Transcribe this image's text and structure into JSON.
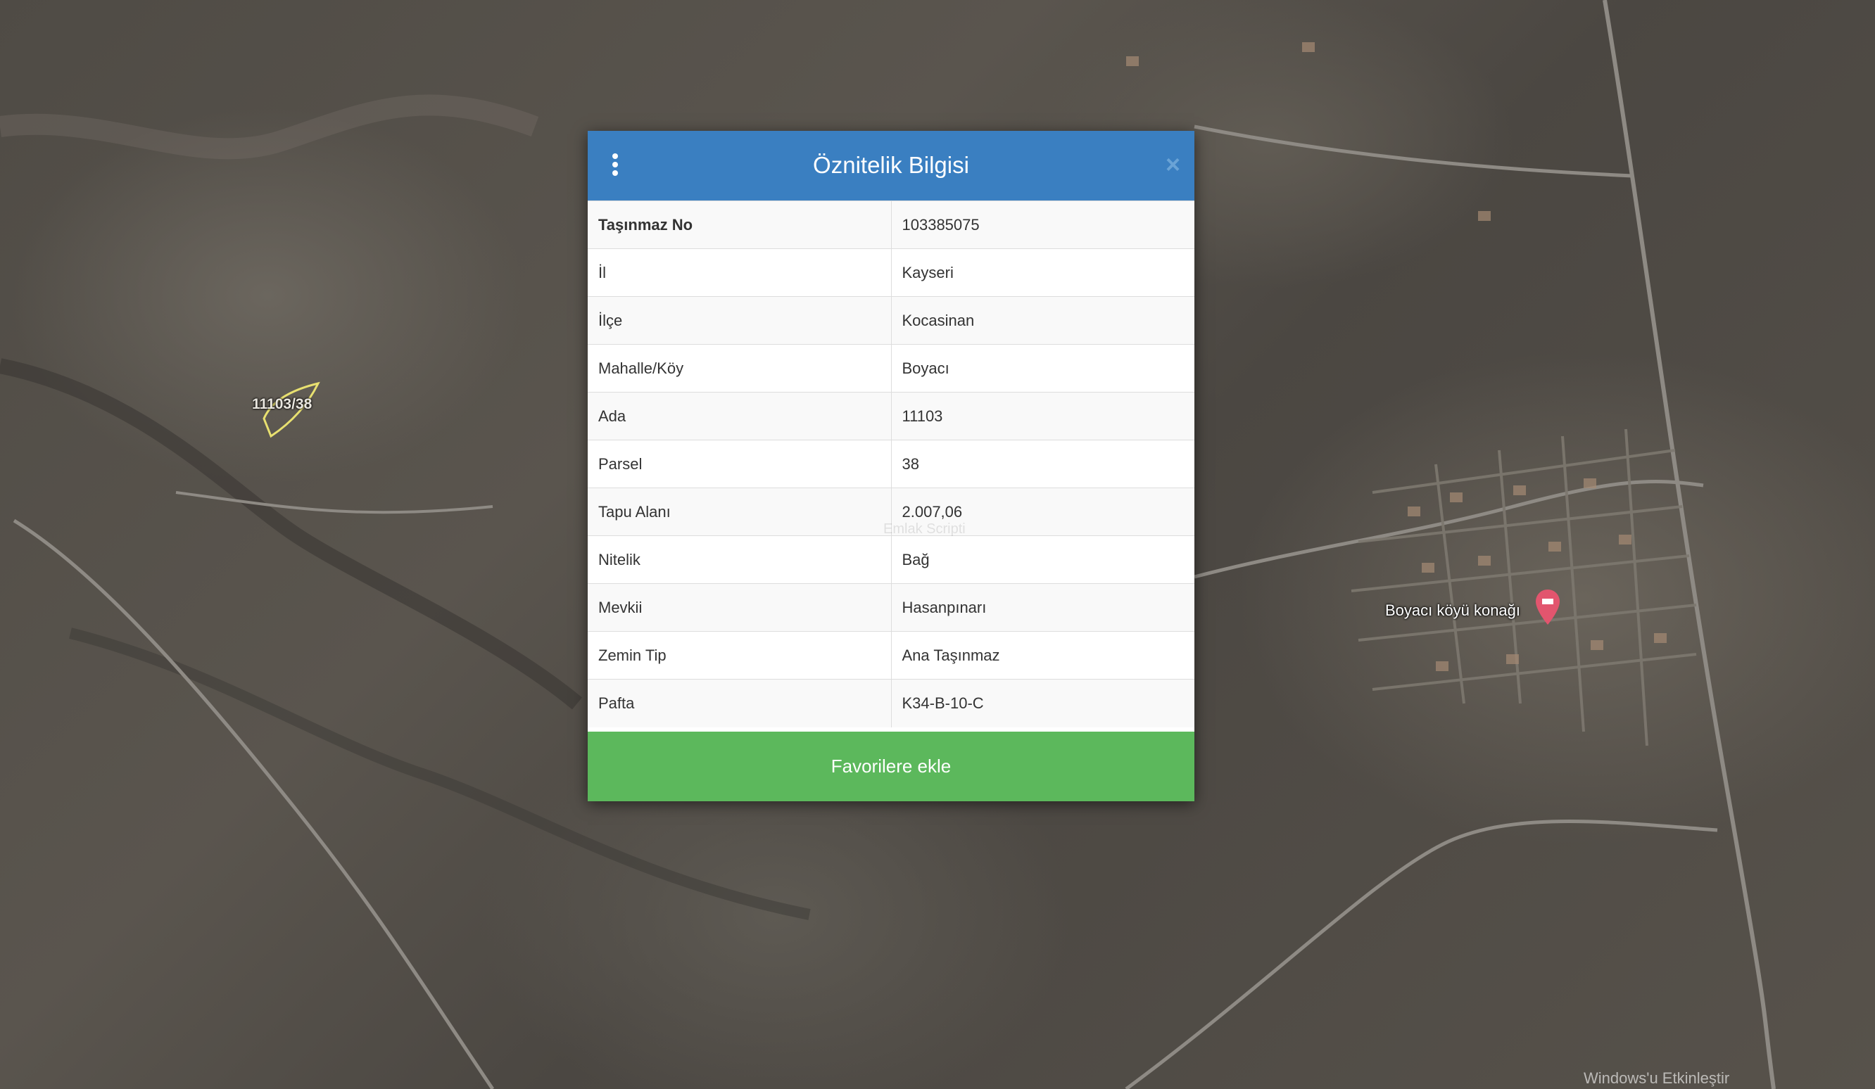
{
  "map": {
    "parcel_label": "11103/38",
    "poi_label": "Boyacı köyü konağı",
    "watermark": "Windows'u Etkinleştir"
  },
  "modal": {
    "title": "Öznitelik Bilgisi",
    "watermark": "Emlak Scripti",
    "rows": [
      {
        "key": "Taşınmaz No",
        "value": "103385075"
      },
      {
        "key": "İl",
        "value": "Kayseri"
      },
      {
        "key": "İlçe",
        "value": "Kocasinan"
      },
      {
        "key": "Mahalle/Köy",
        "value": "Boyacı"
      },
      {
        "key": "Ada",
        "value": "11103"
      },
      {
        "key": "Parsel",
        "value": "38"
      },
      {
        "key": "Tapu Alanı",
        "value": "2.007,06"
      },
      {
        "key": "Nitelik",
        "value": "Bağ"
      },
      {
        "key": "Mevkii",
        "value": "Hasanpınarı"
      },
      {
        "key": "Zemin Tip",
        "value": "Ana Taşınmaz"
      },
      {
        "key": "Pafta",
        "value": "K34-B-10-C"
      }
    ],
    "favorite_button": "Favorilere ekle"
  },
  "colors": {
    "header": "#3a7fc1",
    "button": "#5cb85c"
  },
  "icons": {
    "menu": "vertical-ellipsis-icon",
    "close": "close-icon",
    "poi": "map-pin-icon"
  }
}
